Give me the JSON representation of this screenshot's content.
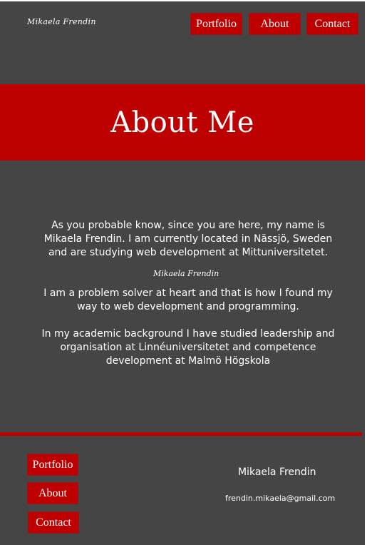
{
  "header": {
    "logo_text": "Mikaela Frendin",
    "nav": {
      "portfolio": "Portfolio",
      "about": "About",
      "contact": "Contact"
    }
  },
  "hero": {
    "title": "About Me"
  },
  "content": {
    "intro": "As you probable know, since you are here, my name is Mikaela Frendin. I am currently located in Nässjö, Sweden and are studying web development at Mittuniversitetet.",
    "signature": "Mikaela Frendin",
    "paragraph2": "I am a problem solver at heart and that is how I found my way to web development and programming.",
    "paragraph3": "In my academic background I have studied leadership and organisation at Linnéuniversitetet and competence development at Malmö Högskola"
  },
  "footer": {
    "nav": {
      "portfolio": "Portfolio",
      "about": "About",
      "contact": "Contact"
    },
    "name": "Mikaela Frendin",
    "email": "frendin.mikaela@gmail.com"
  },
  "colors": {
    "background": "#454545",
    "accent": "#bd0000",
    "text": "#ffffff"
  }
}
